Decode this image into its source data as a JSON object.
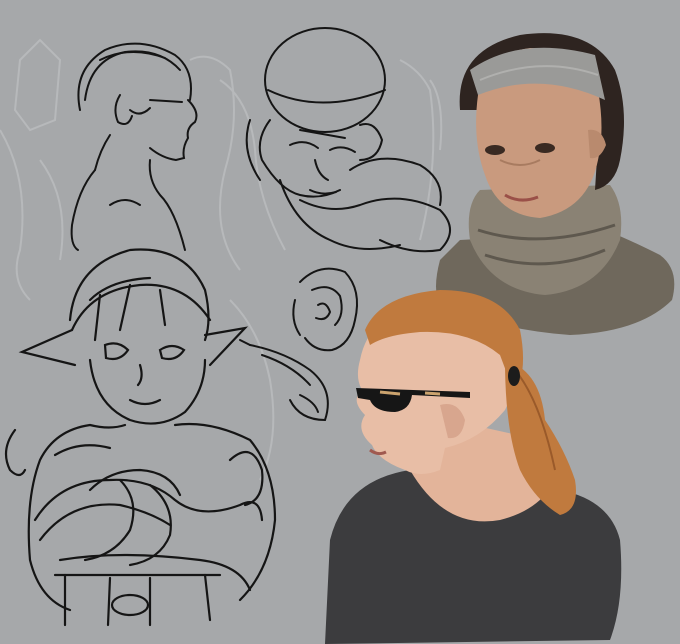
{
  "artwork": {
    "background_color": "#a6a8aa",
    "ghost_sketch_color": "#b7b9bb",
    "ink_color": "#151515",
    "pieces": [
      {
        "name": "profile-sketch",
        "kind": "line-sketch"
      },
      {
        "name": "head-construction-sketch",
        "kind": "line-sketch"
      },
      {
        "name": "ear-study-sketch",
        "kind": "line-sketch"
      },
      {
        "name": "elf-character-sketch",
        "kind": "line-sketch"
      },
      {
        "name": "elf-ear-sketch",
        "kind": "line-sketch"
      },
      {
        "name": "headband-woman-portrait",
        "kind": "painted",
        "skin": "#c99a7e",
        "hair": "#2e2420",
        "band": "#9a9a98",
        "sweater": "#7c7466"
      },
      {
        "name": "glasses-woman-portrait",
        "kind": "painted",
        "skin": "#e8bea6",
        "hair": "#c07a3e",
        "shirt": "#3c3c3e",
        "glasses": "#161616"
      }
    ]
  }
}
